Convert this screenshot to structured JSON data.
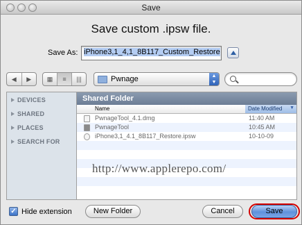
{
  "window": {
    "title": "Save"
  },
  "dialog": {
    "headline": "Save custom .ipsw file.",
    "save_as_label": "Save As:",
    "save_as_value": "iPhone3,1_4,1_8B117_Custom_Restore"
  },
  "toolbar": {
    "back_glyph": "◀",
    "forward_glyph": "▶",
    "view_icon": "▦",
    "list_icon": "≡",
    "column_icon": "|||",
    "location": "Pwnage"
  },
  "sidebar": {
    "items": [
      {
        "label": "DEVICES"
      },
      {
        "label": "SHARED"
      },
      {
        "label": "PLACES"
      },
      {
        "label": "SEARCH FOR"
      }
    ]
  },
  "browser": {
    "header": "Shared Folder",
    "columns": {
      "name": "Name",
      "date": "Date Modified"
    },
    "files": [
      {
        "name": "PwnageTool_4.1.dmg",
        "date": "11:40 AM",
        "icon": "disk-image-icon"
      },
      {
        "name": "PwnageTool",
        "date": "10:45 AM",
        "icon": "app-icon"
      },
      {
        "name": "iPhone3,1_4.1_8B117_Restore.ipsw",
        "date": "10-10-09",
        "icon": "ipsw-file-icon"
      }
    ],
    "watermark": "http://www.applerepo.com/"
  },
  "footer": {
    "hide_extension_label": "Hide extension",
    "hide_extension_checked": true,
    "check_glyph": "✓",
    "new_folder_label": "New Folder",
    "cancel_label": "Cancel",
    "save_label": "Save"
  }
}
